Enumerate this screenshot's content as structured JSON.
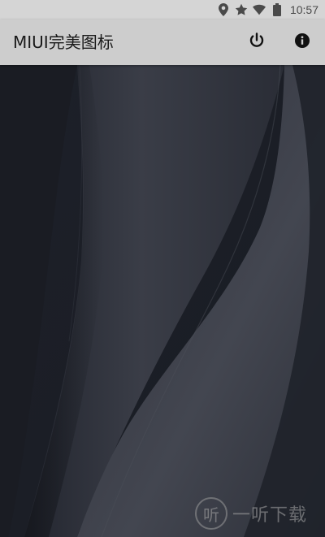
{
  "status_bar": {
    "time": "10:57",
    "icons": [
      "location-icon",
      "star-icon",
      "wifi-icon",
      "battery-icon"
    ]
  },
  "app_bar": {
    "title": "MIUI完美图标",
    "actions": [
      "power-icon",
      "info-icon"
    ]
  },
  "watermark": {
    "logo_char": "听",
    "text": "一听下载"
  },
  "colors": {
    "status_bar_bg": "#d5d5d5",
    "app_bar_bg": "#cdcdcd",
    "wallpaper_base": "#1c1f27",
    "title_text": "#1a1a1a"
  }
}
